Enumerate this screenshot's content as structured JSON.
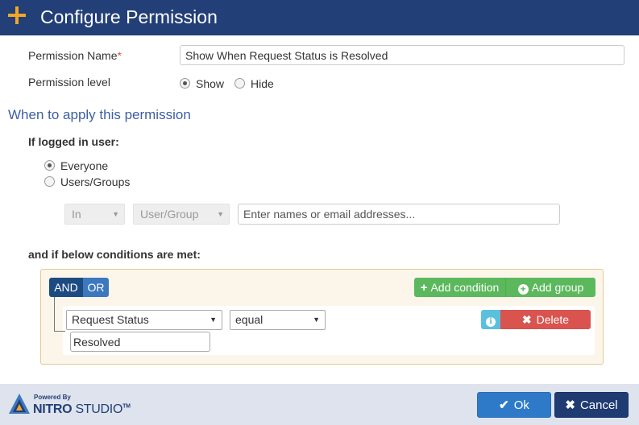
{
  "dialog": {
    "title": "Configure Permission"
  },
  "permission_name": {
    "label": "Permission Name",
    "required_mark": "*",
    "value": "Show When Request Status is Resolved"
  },
  "permission_level": {
    "label": "Permission level",
    "options": [
      {
        "label": "Show",
        "selected": true
      },
      {
        "label": "Hide",
        "selected": false
      }
    ]
  },
  "when_section": {
    "title": "When to apply this permission",
    "logged_in_label": "If logged in user:",
    "user_options": [
      {
        "label": "Everyone",
        "selected": true
      },
      {
        "label": "Users/Groups",
        "selected": false
      }
    ],
    "in_select": "In",
    "usergroup_select": "User/Group",
    "names_placeholder": "Enter names or email addresses...",
    "conditions_label": "and if below conditions are met:"
  },
  "conditions": {
    "and_label": "AND",
    "or_label": "OR",
    "add_condition_label": "Add condition",
    "add_group_label": "Add group",
    "field": "Request Status",
    "operator": "equal",
    "value": "Resolved",
    "delete_label": "Delete"
  },
  "footer": {
    "logo_small": "Powered By",
    "logo_nitro": "NITRO",
    "logo_studio": "STUDIO",
    "logo_tm": "TM",
    "ok_label": "Ok",
    "cancel_label": "Cancel"
  },
  "colors": {
    "header": "#223f77",
    "accent_orange": "#f0a728",
    "green": "#5cb85c",
    "danger": "#d9534f",
    "info": "#5bc0de",
    "primary": "#2e7ac9"
  },
  "icons": [
    "plus-icon",
    "check-icon",
    "times-icon",
    "plus-circle-icon",
    "info-icon",
    "caret-down-icon"
  ]
}
